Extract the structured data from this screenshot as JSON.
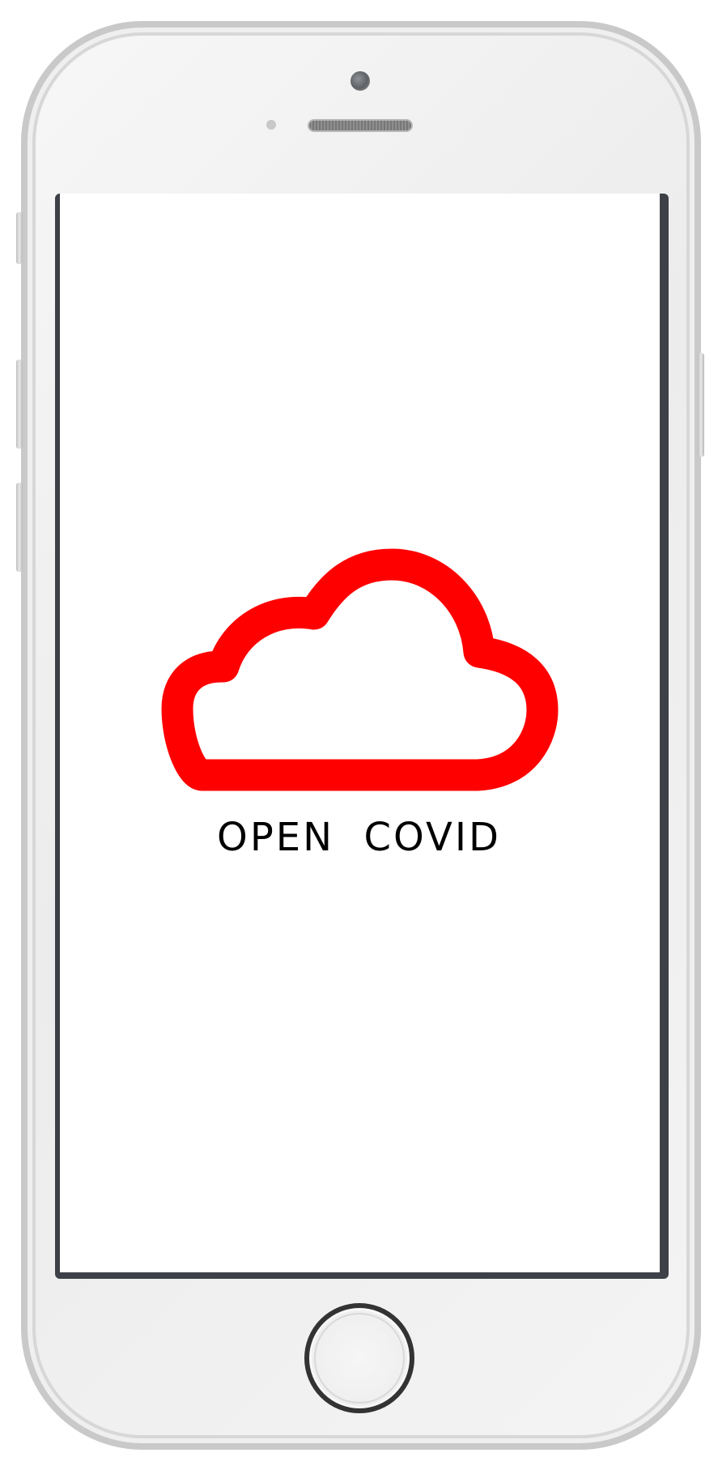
{
  "device": {
    "type": "smartphone",
    "body_color": "#f0f0f0",
    "screen_bezel_color": "#3d4147"
  },
  "app": {
    "logo_icon": "cloud-icon",
    "logo_color": "#ff0000",
    "title": "OPEN  COVID"
  }
}
